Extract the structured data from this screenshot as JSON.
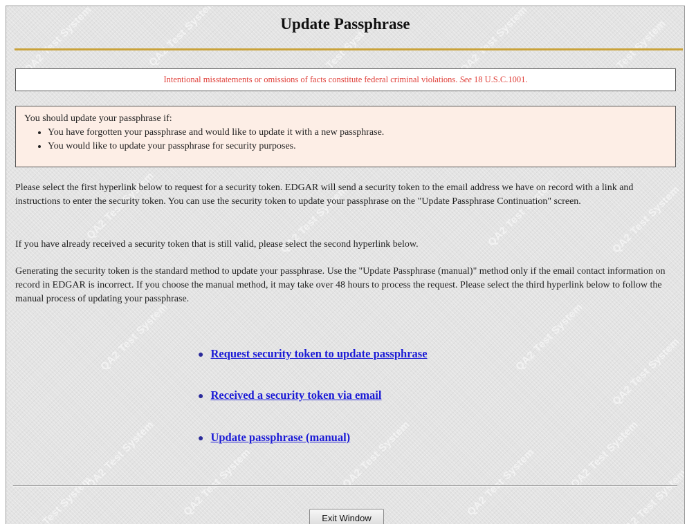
{
  "page": {
    "title": "Update Passphrase"
  },
  "watermark": {
    "text": "QA2 Test System"
  },
  "warning": {
    "text_before": "Intentional misstatements or omissions of facts constitute federal criminal violations. ",
    "see": "See",
    "text_after": " 18 U.S.C.1001."
  },
  "info": {
    "intro": "You should update your passphrase if:",
    "items": [
      "You have forgotten your passphrase and would like to update it with a new passphrase.",
      "You would like to update your passphrase for security purposes."
    ]
  },
  "paragraphs": [
    "Please select the first hyperlink below to request for a security token. EDGAR will send a security token to the email address we have on record with a link and instructions to enter the security token. You can use the security token to update your passphrase on the \"Update Passphrase Continuation\" screen.",
    "If you have already received a security token that is still valid, please select the second hyperlink below.",
    "Generating the security token is the standard method to update your passphrase. Use the \"Update Passphrase (manual)\" method only if the email contact information on record in EDGAR is incorrect. If you choose the manual method, it may take over 48 hours to process the request. Please select the third hyperlink below to follow the manual process of updating your passphrase."
  ],
  "links": [
    "Request security token to update passphrase",
    "Received a security token via email",
    "Update passphrase (manual)"
  ],
  "footer": {
    "exit_label": "Exit Window"
  },
  "colors": {
    "warning_text": "#e0403a",
    "info_background": "#fdeee6",
    "gold_rule": "#c9a23a",
    "link": "#1b1bd6"
  }
}
